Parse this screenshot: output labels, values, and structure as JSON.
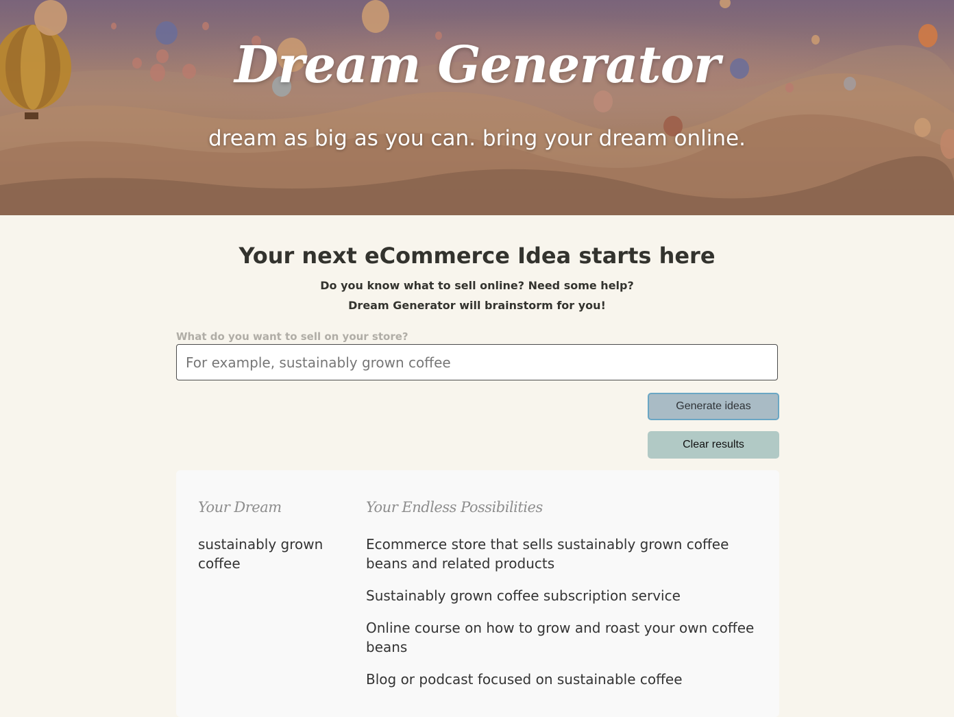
{
  "hero": {
    "title": "Dream Generator",
    "tagline": "dream as big as you can. bring your dream online."
  },
  "intro": {
    "heading": "Your next eCommerce Idea starts here",
    "line1": "Do you know what to sell online? Need some help?",
    "line2": "Dream Generator will brainstorm for you!"
  },
  "form": {
    "label": "What do you want to sell on your store?",
    "placeholder": "For example, sustainably grown coffee",
    "value": "",
    "generate_label": "Generate ideas",
    "clear_label": "Clear results"
  },
  "results": {
    "dream_heading": "Your Dream",
    "possibilities_heading": "Your Endless Possibilities",
    "dream": "sustainably grown coffee",
    "ideas": [
      "Ecommerce store that sells sustainably grown coffee beans and related products",
      "Sustainably grown coffee subscription service",
      "Online course on how to grow and roast your own coffee beans",
      "Blog or podcast focused on sustainable coffee"
    ]
  },
  "colors": {
    "page_bg": "#f8f5ed",
    "generate_bg": "#a9bbc5",
    "generate_border": "#6aa6c4",
    "clear_bg": "#b1c9c5",
    "panel_bg": "#f9f9f9"
  }
}
